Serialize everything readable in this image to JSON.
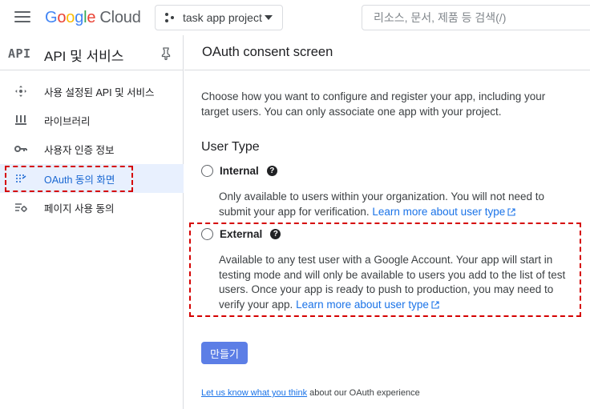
{
  "topbar": {
    "logo": {
      "g1": "G",
      "g2": "o",
      "g3": "o",
      "g4": "g",
      "g5": "l",
      "g6": "e",
      "cloud": "Cloud"
    },
    "project": "task app project",
    "search_placeholder": "리소스, 문서, 제품 등 검색(/)"
  },
  "sidebar": {
    "badge": "API",
    "title": "API 및 서비스",
    "items": [
      {
        "label": "사용 설정된 API 및 서비스",
        "icon": "enabled-apis-icon"
      },
      {
        "label": "라이브러리",
        "icon": "library-icon"
      },
      {
        "label": "사용자 인증 정보",
        "icon": "key-icon"
      },
      {
        "label": "OAuth 동의 화면",
        "icon": "oauth-consent-icon"
      },
      {
        "label": "페이지 사용 동의",
        "icon": "page-usage-agreement-icon"
      }
    ],
    "active_index": 3
  },
  "main": {
    "title": "OAuth consent screen",
    "description": "Choose how you want to configure and register your app, including your target users. You can only associate one app with your project.",
    "user_type_title": "User Type",
    "options": [
      {
        "label": "Internal",
        "description": "Only available to users within your organization. You will not need to submit your app for verification.",
        "link": "Learn more about user type"
      },
      {
        "label": "External",
        "description": "Available to any test user with a Google Account. Your app will start in testing mode and will only be available to users you add to the list of test users. Once your app is ready to push to production, you may need to verify your app.",
        "link": "Learn more about user type"
      }
    ],
    "create_label": "만들기",
    "footer_link": "Let us know what you think",
    "footer_text": " about our OAuth experience"
  },
  "colors": {
    "accent": "#1a73e8",
    "active_bg": "#e8f0fe",
    "highlight": "#d50000",
    "button": "#5c7ee6"
  }
}
